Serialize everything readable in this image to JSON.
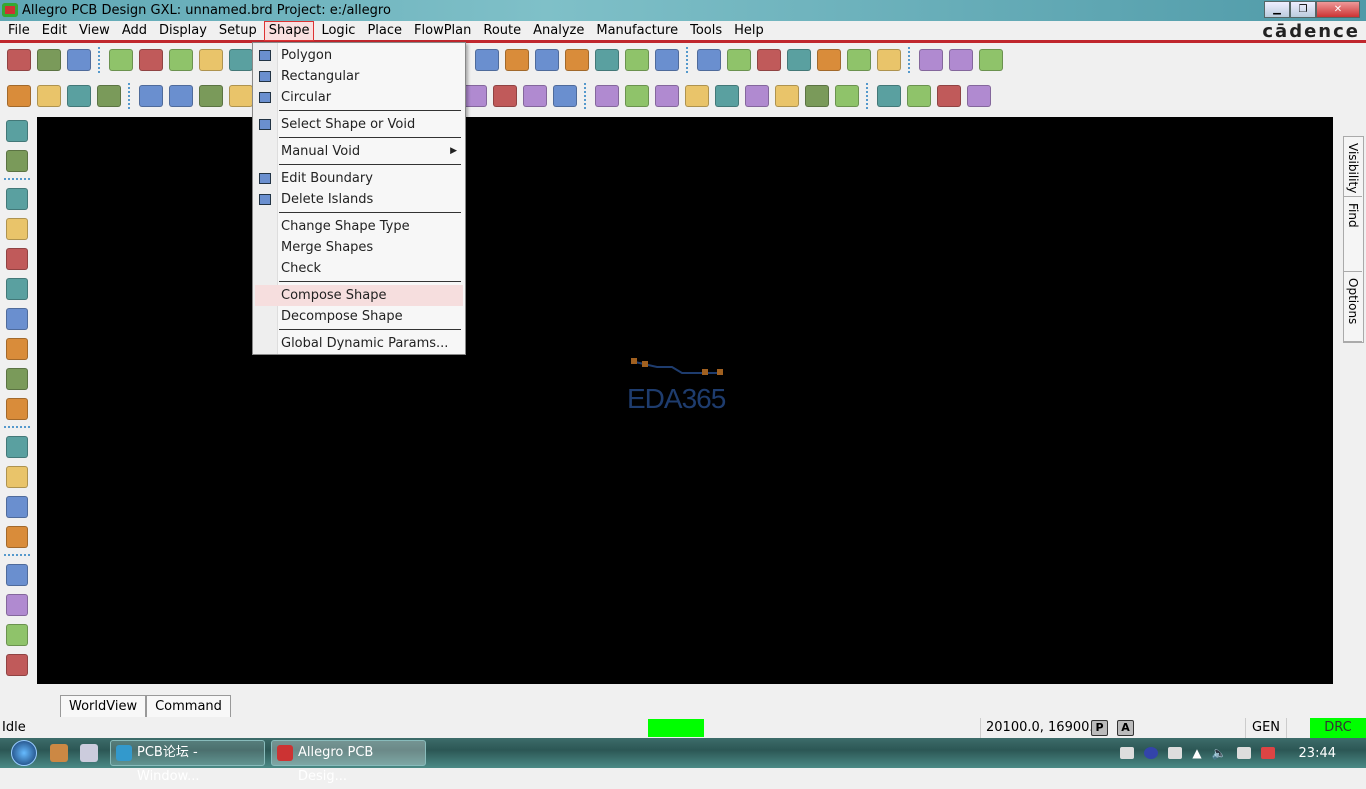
{
  "window": {
    "title": "Allegro PCB Design GXL: unnamed.brd  Project: e:/allegro",
    "brand": "cādence",
    "controls": [
      "minimize",
      "restore",
      "close"
    ]
  },
  "menubar": [
    "File",
    "Edit",
    "View",
    "Add",
    "Display",
    "Setup",
    "Shape",
    "Logic",
    "Place",
    "FlowPlan",
    "Route",
    "Analyze",
    "Manufacture",
    "Tools",
    "Help"
  ],
  "active_menu": "Shape",
  "shape_menu": [
    {
      "label": "Polygon",
      "icon": "polygon-icon"
    },
    {
      "label": "Rectangular",
      "icon": "rectangle-icon"
    },
    {
      "label": "Circular",
      "icon": "circle-icon"
    },
    {
      "sep": true
    },
    {
      "label": "Select Shape or Void",
      "icon": "select-shape-icon"
    },
    {
      "sep": true
    },
    {
      "label": "Manual Void",
      "submenu": true
    },
    {
      "sep": true
    },
    {
      "label": "Edit Boundary",
      "icon": "edit-boundary-icon"
    },
    {
      "label": "Delete Islands",
      "icon": "delete-islands-icon"
    },
    {
      "sep": true
    },
    {
      "label": "Change Shape Type"
    },
    {
      "label": "Merge Shapes"
    },
    {
      "label": "Check"
    },
    {
      "sep": true
    },
    {
      "label": "Compose Shape",
      "highlighted": true
    },
    {
      "label": "Decompose Shape"
    },
    {
      "sep": true
    },
    {
      "label": "Global Dynamic Params..."
    }
  ],
  "toolbar1": [
    "new",
    "open",
    "save",
    "|",
    "move",
    "copy",
    "delete",
    "undo",
    "redo",
    "|",
    "|",
    "zoom-points",
    "zoom-in",
    "zoom-out",
    "zoom-world",
    "zoom-fit",
    "redraw",
    "|",
    "grid",
    "color",
    "layers",
    "stackup",
    "cm",
    "dfa",
    "3d",
    "|",
    "info",
    "reports",
    "measure",
    "paint",
    "bomb",
    "spreadsheet",
    "hourglass",
    "|",
    "windows",
    "mail",
    "help"
  ],
  "toolbar2": [
    "place1",
    "place2",
    "place3",
    "place4",
    "|",
    "add-polygon",
    "add-rect",
    "add-circle",
    "add-frect",
    "|",
    "|",
    "fixture",
    "dim1",
    "dim2",
    "dim3",
    "angle",
    "line",
    "circle-dim",
    "cross",
    "coin",
    "angle2",
    "|",
    "odb",
    "ipc",
    "probe",
    "camera",
    "refdes",
    "flag",
    "grid2",
    "testprep",
    "matrix",
    "|",
    "book",
    "trace",
    "check",
    "wire"
  ],
  "left_toolbar": [
    "place-manual",
    "place-refdes",
    "|",
    "add-connect",
    "slide",
    "vias",
    "delay-tune",
    "custom-smooth",
    "spread",
    "route-bundle",
    "auto-interactive",
    "|",
    "add-line",
    "add-rect-l",
    "add-text",
    "edit-text",
    "|",
    "cline-1",
    "cline-2",
    "cline-3",
    "cline-4"
  ],
  "right_tabs": [
    "Visibility",
    "Find",
    "Options"
  ],
  "canvas": {
    "watermark": "EDA365"
  },
  "bottom_tabs": [
    "WorldView",
    "Command"
  ],
  "status": {
    "state": "Idle",
    "coords": "20100.0, 16900.0",
    "p": "P",
    "a": "A",
    "mode": "GEN",
    "drc": "DRC"
  },
  "taskbar": {
    "tasks": [
      {
        "label": "PCB论坛 - Window..."
      },
      {
        "label": "Allegro PCB Desig..."
      }
    ],
    "clock": "23:44"
  },
  "colors": {
    "accent": "#c0272d",
    "drc": "#00ff00",
    "canvas": "#000000"
  }
}
